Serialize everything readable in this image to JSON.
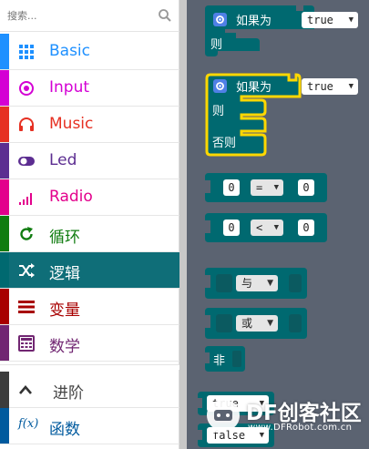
{
  "search": {
    "placeholder": "搜索..."
  },
  "categories": [
    {
      "label": "Basic",
      "color": "#1e90ff",
      "icon": "grid-icon"
    },
    {
      "label": "Input",
      "color": "#d400d4",
      "icon": "target-icon"
    },
    {
      "label": "Music",
      "color": "#e63022",
      "icon": "headphones-icon"
    },
    {
      "label": "Led",
      "color": "#5c2d91",
      "icon": "toggle-icon"
    },
    {
      "label": "Radio",
      "color": "#e3008c",
      "icon": "signal-bars-icon"
    },
    {
      "label": "循环",
      "color": "#107c10",
      "icon": "refresh-icon"
    },
    {
      "label": "逻辑",
      "color": "#006970",
      "icon": "shuffle-icon",
      "selected": true
    },
    {
      "label": "变量",
      "color": "#a80000",
      "icon": "list-lines-icon"
    },
    {
      "label": "数学",
      "color": "#712672",
      "icon": "calculator-icon"
    }
  ],
  "advanced": {
    "label": "进阶",
    "color": "#3c3c3c",
    "icon": "chevron-up-icon"
  },
  "functions": {
    "label": "函数",
    "color": "#005a9e",
    "icon": "fx-icon"
  },
  "flyout": {
    "if_block": {
      "if": "如果为",
      "then": "则",
      "value": "true"
    },
    "if_else_block": {
      "if": "如果为",
      "then": "则",
      "else": "否则",
      "value": "true"
    },
    "compare_eq": {
      "left": "0",
      "op": "=",
      "right": "0"
    },
    "compare_lt": {
      "left": "0",
      "op": "<",
      "right": "0"
    },
    "and_block": {
      "op": "与"
    },
    "or_block": {
      "op": "或"
    },
    "not_block": {
      "label": "非"
    },
    "true_block": {
      "value": "true"
    },
    "false_block": {
      "value": "false"
    }
  },
  "watermark": {
    "text": "DF创客社区",
    "url": "www.DFRobot.com.cn"
  }
}
